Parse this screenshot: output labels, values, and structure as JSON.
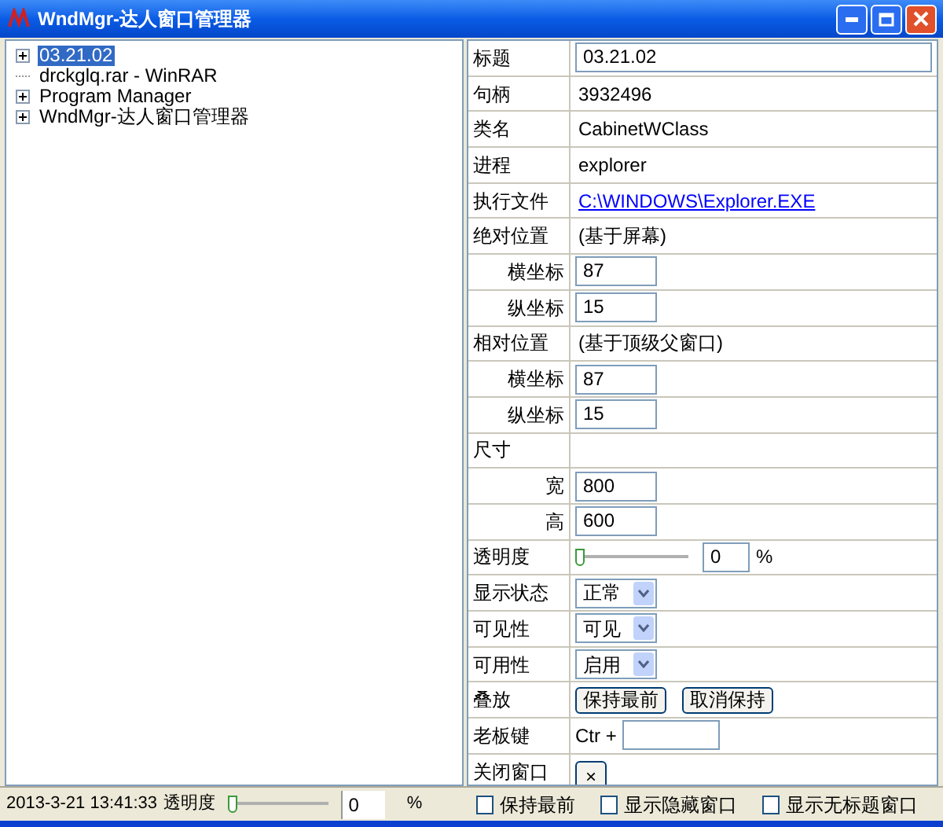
{
  "window": {
    "title": "WndMgr-达人窗口管理器"
  },
  "tree": [
    {
      "label": "03.21.02",
      "expandable": true,
      "selected": true
    },
    {
      "label": "drckglq.rar - WinRAR",
      "expandable": false,
      "selected": false
    },
    {
      "label": "Program Manager",
      "expandable": true,
      "selected": false
    },
    {
      "label": "WndMgr-达人窗口管理器",
      "expandable": true,
      "selected": false
    }
  ],
  "properties": [
    {
      "label": "标题",
      "kind": "wide_field",
      "value": "03.21.02"
    },
    {
      "label": "句柄",
      "kind": "text",
      "value": "3932496"
    },
    {
      "label": "类名",
      "kind": "text",
      "value": "CabinetWClass"
    },
    {
      "label": "进程",
      "kind": "text",
      "value": "explorer"
    },
    {
      "label": "执行文件",
      "kind": "link",
      "value": "C:\\WINDOWS\\Explorer.EXE"
    },
    {
      "label": "绝对位置",
      "kind": "text",
      "value": "(基于屏幕)",
      "children": [
        {
          "label": "横坐标",
          "kind": "field",
          "value": "87"
        },
        {
          "label": "纵坐标",
          "kind": "field",
          "value": "15"
        }
      ]
    },
    {
      "label": "相对位置",
      "kind": "text",
      "value": "(基于顶级父窗口)",
      "children": [
        {
          "label": "横坐标",
          "kind": "field",
          "value": "87"
        },
        {
          "label": "纵坐标",
          "kind": "field",
          "value": "15"
        }
      ]
    },
    {
      "label": "尺寸",
      "kind": "text",
      "children": [
        {
          "label": "宽",
          "kind": "field",
          "value": "800"
        },
        {
          "label": "高",
          "kind": "field",
          "value": "600"
        }
      ]
    },
    {
      "label": "透明度",
      "kind": "slider",
      "level": 0,
      "value": "0",
      "unit": "%"
    },
    {
      "label": "显示状态",
      "kind": "select",
      "value": "正常"
    },
    {
      "label": "可见性",
      "kind": "select",
      "value": "可见"
    },
    {
      "label": "可用性",
      "kind": "select",
      "value": "启用"
    },
    {
      "label": "叠放",
      "kind": "buttons",
      "buttons": [
        "保持最前",
        "取消保持"
      ]
    },
    {
      "label": "老板键",
      "kind": "hotkey",
      "prefix": "Ctr +"
    },
    {
      "label": "关闭窗口",
      "kind": "close",
      "button": "×"
    }
  ],
  "status_bar": {
    "time": "2013-3-21 13:41:33",
    "opacity_label": "透明度",
    "level": 0,
    "value": "0",
    "unit": "%",
    "checkboxes": [
      {
        "label": "保持最前",
        "checked": false
      },
      {
        "label": "显示隐藏窗口",
        "checked": false
      },
      {
        "label": "显示无标题窗口",
        "checked": false
      }
    ]
  }
}
